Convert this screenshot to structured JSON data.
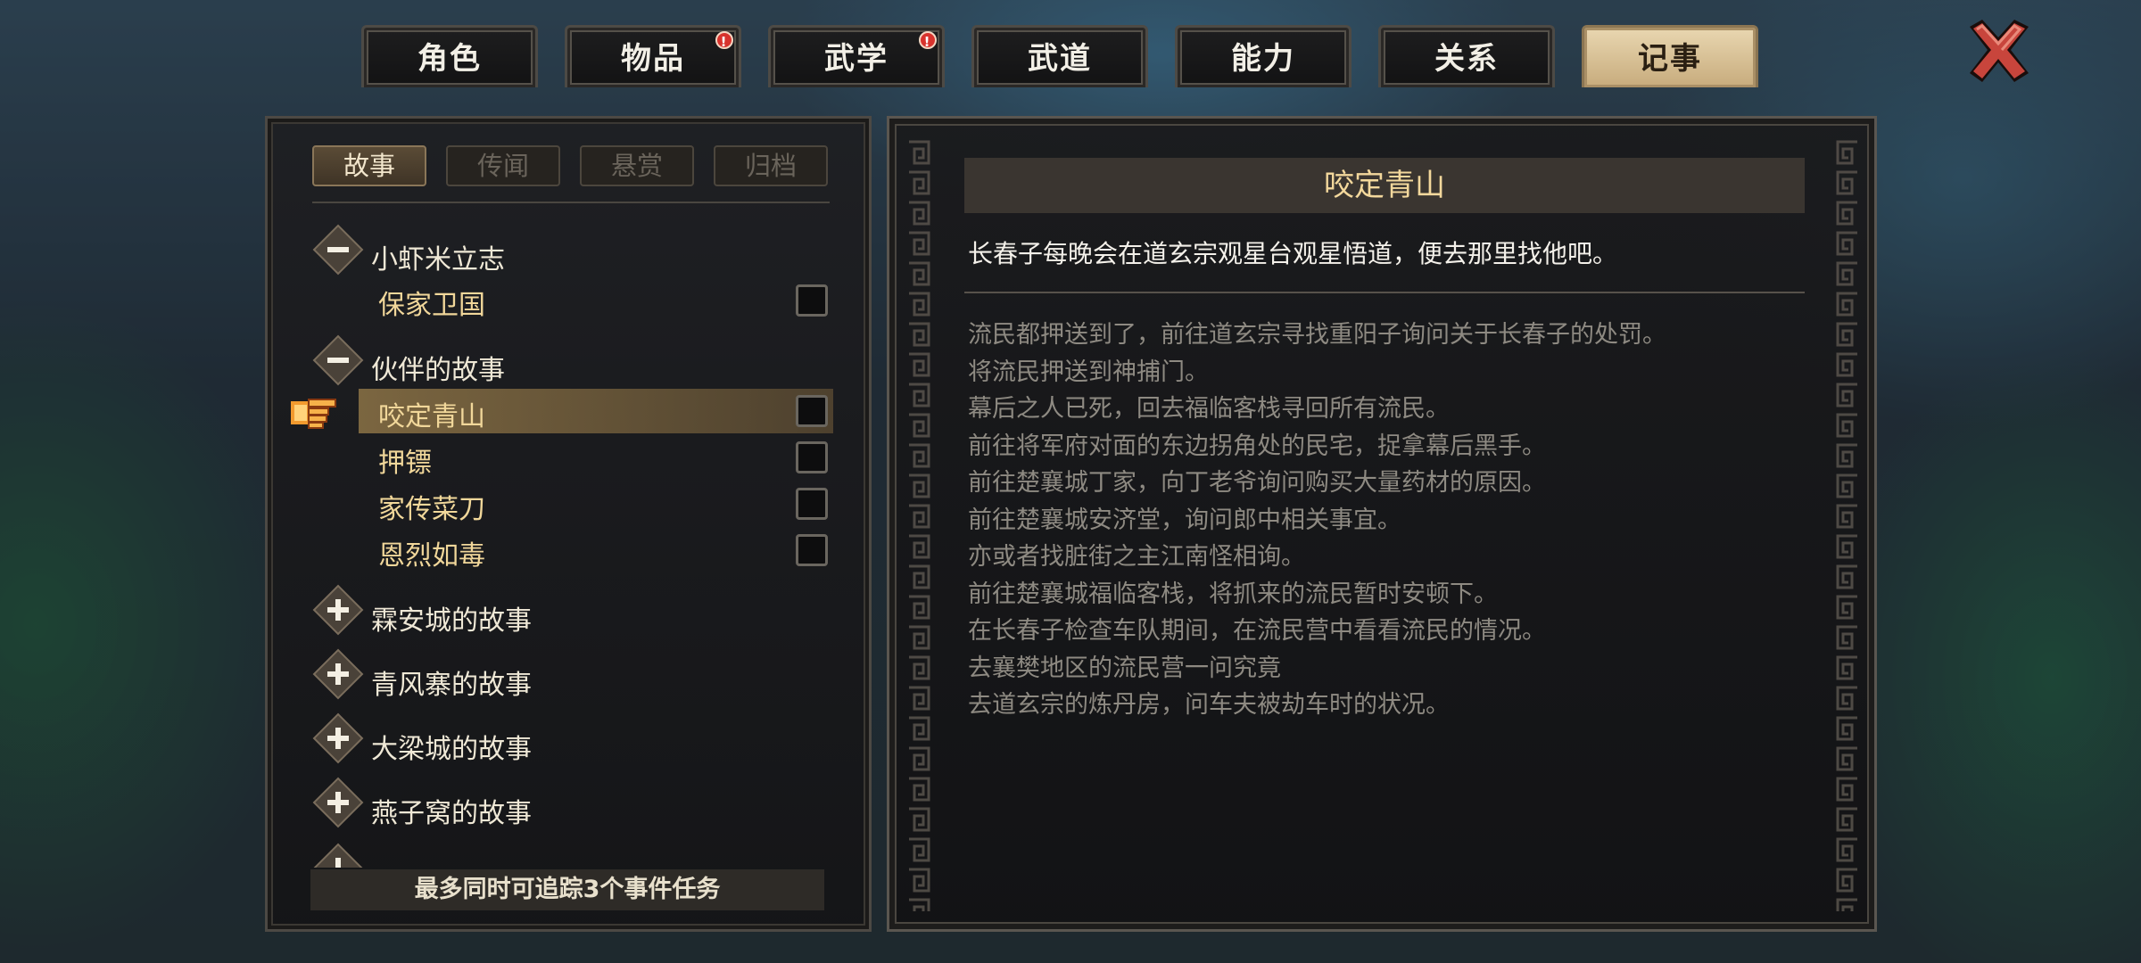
{
  "top_tabs": [
    {
      "label": "角色",
      "badge": false
    },
    {
      "label": "物品",
      "badge": true
    },
    {
      "label": "武学",
      "badge": true
    },
    {
      "label": "武道",
      "badge": false
    },
    {
      "label": "能力",
      "badge": false
    },
    {
      "label": "关系",
      "badge": false
    },
    {
      "label": "记事",
      "badge": false,
      "active": true
    }
  ],
  "badge_mark": "!",
  "sub_tabs": [
    "故事",
    "传闻",
    "悬赏",
    "归档"
  ],
  "active_sub_tab": "故事",
  "quest_groups": [
    {
      "title": "小虾米立志",
      "expanded": true,
      "items": [
        "保家卫国"
      ]
    },
    {
      "title": "伙伴的故事",
      "expanded": true,
      "items": [
        "咬定青山",
        "押镖",
        "家传菜刀",
        "恩烈如毒"
      ]
    },
    {
      "title": "霖安城的故事",
      "expanded": false,
      "items": []
    },
    {
      "title": "青风寨的故事",
      "expanded": false,
      "items": []
    },
    {
      "title": "大梁城的故事",
      "expanded": false,
      "items": []
    },
    {
      "title": "燕子窝的故事",
      "expanded": false,
      "items": []
    }
  ],
  "selected_item": "咬定青山",
  "footer_note": "最多同时可追踪3个事件任务",
  "detail": {
    "title": "咬定青山",
    "current_objective": "长春子每晚会在道玄宗观星台观星悟道，便去那里找他吧。",
    "history": [
      "流民都押送到了，前往道玄宗寻找重阳子询问关于长春子的处罚。",
      "将流民押送到神捕门。",
      "幕后之人已死，回去福临客栈寻回所有流民。",
      "前往将军府对面的东边拐角处的民宅，捉拿幕后黑手。",
      "前往楚襄城丁家，向丁老爷询问购买大量药材的原因。",
      "前往楚襄城安济堂，询问郎中相关事宜。",
      "亦或者找脏街之主江南怪相询。",
      "前往楚襄城福临客栈，将抓来的流民暂时安顿下。",
      "在长春子检查车队期间，在流民营中看看流民的情况。",
      "去襄樊地区的流民营一问究竟",
      "去道玄宗的炼丹房，问车夫被劫车时的状况。"
    ]
  },
  "colors": {
    "accent": "#f3d89c",
    "active_tab": "#d9c296",
    "badge": "#d8332d",
    "close": "#c8453c"
  },
  "icons": {
    "close": "close-icon",
    "expanded": "minus-icon",
    "collapsed": "plus-icon",
    "pointer": "pointing-hand-icon"
  }
}
